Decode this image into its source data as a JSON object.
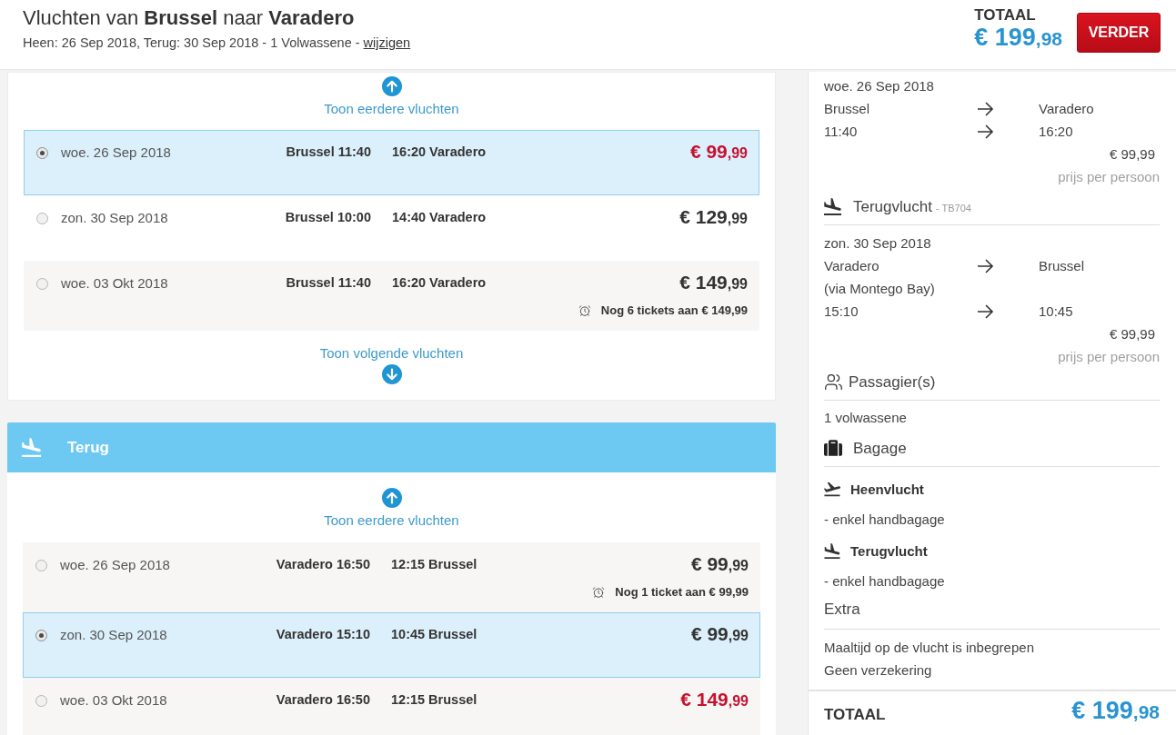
{
  "header": {
    "title": "Vluchten van **Brussel** naar **Varadero**",
    "subtitle": "Heen: 26 Sep 2018, Terug: 30 Sep 2018 - 1 Volwassene -",
    "change_link": "wijzigen",
    "total_label": "TOTAAL",
    "total_price": "€ 199",
    "total_cents": ",98",
    "continue_button": "VERDER"
  },
  "outbound": {
    "earlier_link": "Toon eerdere vluchten",
    "flights": [
      {
        "selected": true,
        "date": "woe. 26 Sep 2018",
        "departure": "Brussel 11:40",
        "arrival": "16:20 Varadero",
        "price": "€ 99",
        "cents": ",99",
        "color": "#c8102e"
      },
      {
        "selected": false,
        "date": "zon. 30 Sep 2018",
        "departure": "Brussel 10:00",
        "arrival": "14:40 Varadero",
        "price": "€ 129",
        "cents": ",99",
        "color": "#333333"
      },
      {
        "selected": false,
        "date": "woe. 03 Okt 2018",
        "departure": "Brussel 11:40",
        "arrival": "16:20 Varadero",
        "price": "€ 149",
        "cents": ",99",
        "color": "#333333",
        "note": "Nog 6 tickets aan € 149,99"
      }
    ],
    "later_link": "Toon volgende vluchten"
  },
  "return": {
    "title": "Terug",
    "earlier_link": "Toon eerdere vluchten",
    "flights": [
      {
        "selected": false,
        "date": "woe. 26 Sep 2018",
        "departure": "Varadero 16:50",
        "arrival": "12:15 Brussel",
        "price": "€ 99",
        "cents": ",99",
        "color": "#333333",
        "note": "Nog 1 ticket aan € 99,99"
      },
      {
        "selected": true,
        "date": "zon. 30 Sep 2018",
        "departure": "Varadero 15:10",
        "arrival": "10:45 Brussel",
        "price": "€ 99",
        "cents": ",99",
        "color": "#333333"
      },
      {
        "selected": false,
        "date": "woe. 03 Okt 2018",
        "departure": "Varadero 16:50",
        "arrival": "12:15 Brussel",
        "price": "€ 149",
        "cents": ",99",
        "color": "#c8102e"
      }
    ]
  },
  "summary": {
    "outbound": {
      "date": "woe. 26 Sep 2018",
      "route": [
        {
          "from": "Brussel",
          "to": "Varadero"
        },
        {
          "from": "11:40",
          "to": "16:20"
        }
      ],
      "price": "€ 99,99",
      "price_note": "prijs per persoon"
    },
    "return": {
      "title": "Terugvlucht",
      "flight_code": "- TB704",
      "date": "zon. 30 Sep 2018",
      "route": [
        {
          "from": "Varadero",
          "to": "Brussel"
        },
        {
          "from": "(via Montego Bay)"
        },
        {
          "from": "15:10",
          "to": "10:45"
        }
      ],
      "price": "€ 99,99",
      "price_note": "prijs per persoon"
    },
    "passengers": {
      "title": "Passagier(s)",
      "lines": [
        "1 volwassene"
      ]
    },
    "baggage": {
      "title": "Bagage",
      "items": [
        {
          "kind": "takeoff",
          "title": "Heenvlucht",
          "detail": "- enkel handbagage"
        },
        {
          "kind": "landing",
          "title": "Terugvlucht",
          "detail": "- enkel handbagage"
        }
      ]
    },
    "extra": {
      "title": "Extra",
      "lines": [
        "Maaltijd op de vlucht is inbegrepen",
        "Geen verzekering"
      ]
    },
    "total": {
      "label": "TOTAAL",
      "price": "€ 199",
      "cents": ",98"
    }
  }
}
